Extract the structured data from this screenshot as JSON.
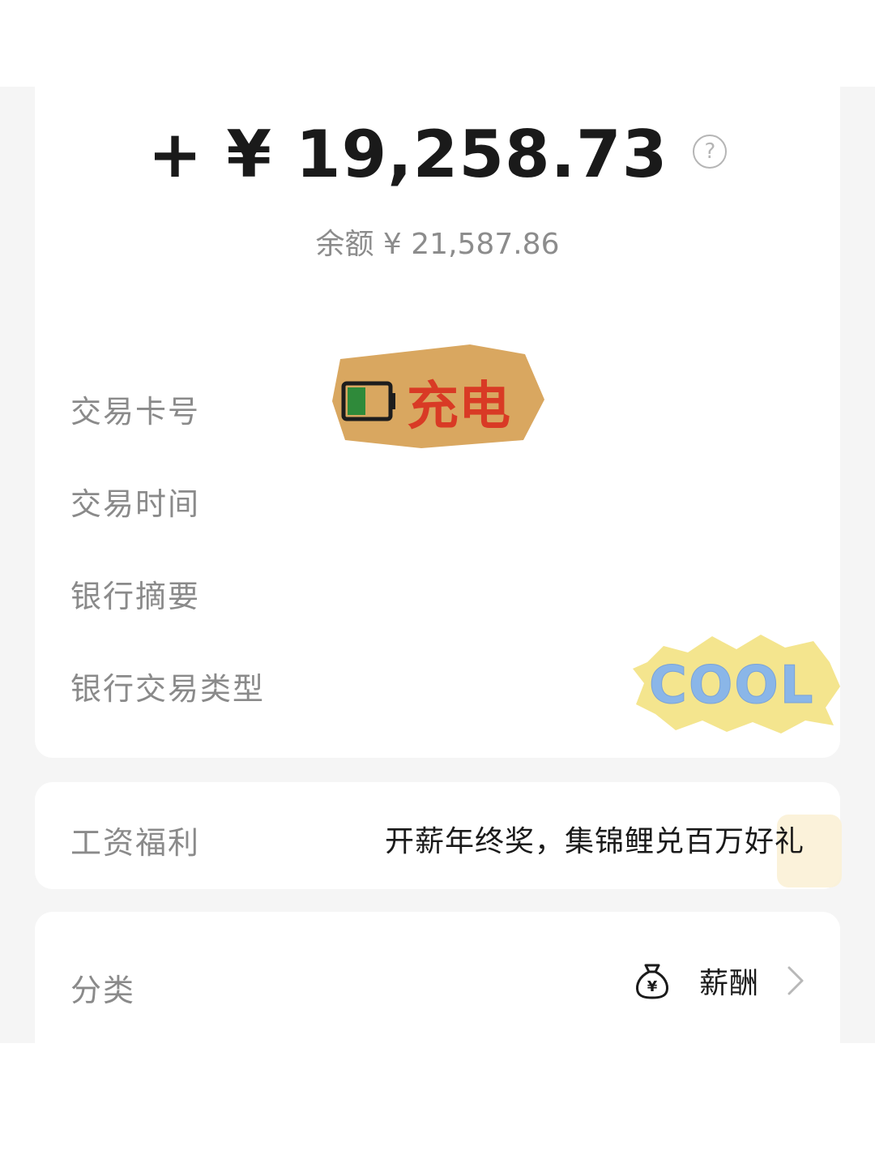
{
  "transaction": {
    "amount": "+ ¥ 19,258.73",
    "balance": "余额 ¥ 21,587.86"
  },
  "fields": [
    {
      "label": "交易卡号"
    },
    {
      "label": "交易时间"
    },
    {
      "label": "银行摘要"
    },
    {
      "label": "银行交易类型"
    }
  ],
  "stickers": {
    "charge_text": "充电",
    "cool_text": "COOL"
  },
  "promo": {
    "label": "工资福利",
    "text": "开薪年终奖，集锦鲤兑百万好礼"
  },
  "category": {
    "label": "分类",
    "value": "薪酬",
    "icon": "money-bag-icon"
  },
  "colors": {
    "text_primary": "#1a1a1a",
    "text_secondary": "#8a8a8a",
    "background": "#f5f5f5",
    "card": "#ffffff"
  }
}
